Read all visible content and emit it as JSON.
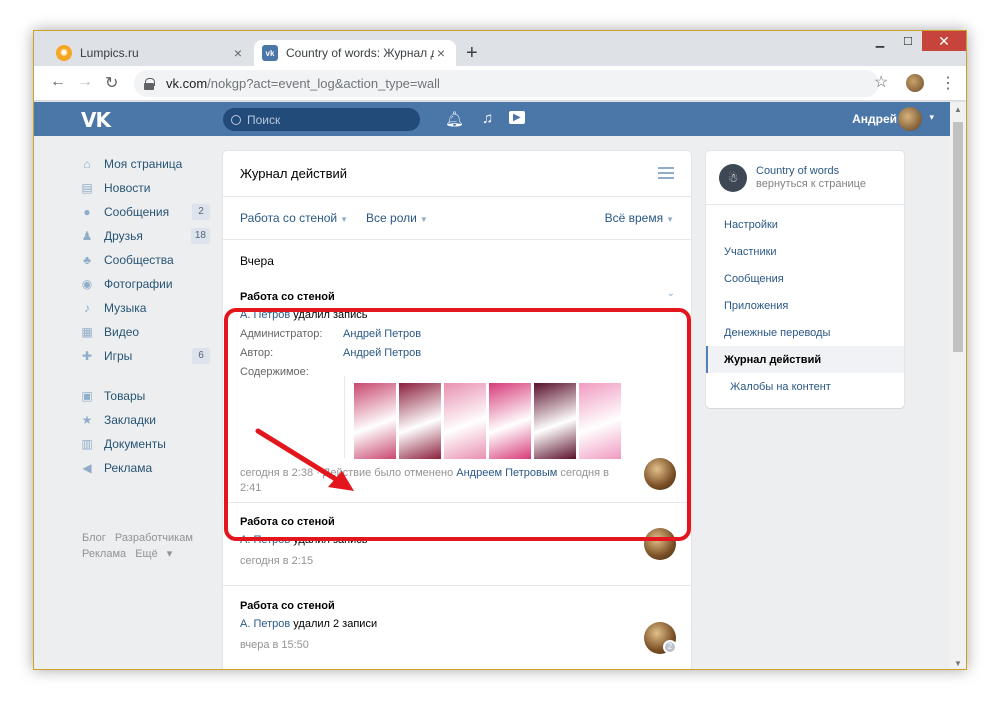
{
  "browser": {
    "tabs": [
      {
        "label": "Lumpics.ru"
      },
      {
        "label": "Country of words: Журнал действ"
      }
    ],
    "url_domain": "vk.com",
    "url_path": "/nokgp?act=event_log&action_type=wall"
  },
  "vk": {
    "search_placeholder": "Поиск",
    "user_name": "Андрей",
    "left_nav": [
      {
        "label": "Моя страница",
        "icon": "home-icon"
      },
      {
        "label": "Новости",
        "icon": "news-icon"
      },
      {
        "label": "Сообщения",
        "icon": "messages-icon",
        "count": "2"
      },
      {
        "label": "Друзья",
        "icon": "friends-icon",
        "count": "18"
      },
      {
        "label": "Сообщества",
        "icon": "groups-icon"
      },
      {
        "label": "Фотографии",
        "icon": "camera-icon"
      },
      {
        "label": "Музыка",
        "icon": "music-icon"
      },
      {
        "label": "Видео",
        "icon": "video-icon"
      },
      {
        "label": "Игры",
        "icon": "games-icon",
        "count": "6"
      },
      {
        "label": "Товары",
        "icon": "shop-icon"
      },
      {
        "label": "Закладки",
        "icon": "star-icon"
      },
      {
        "label": "Документы",
        "icon": "docs-icon"
      },
      {
        "label": "Реклама",
        "icon": "ads-icon"
      }
    ],
    "footer": [
      "Блог",
      "Разработчикам",
      "Реклама",
      "Ещё"
    ]
  },
  "main": {
    "title": "Журнал действий",
    "filter_section": "Работа со стеной",
    "filter_roles": "Все роли",
    "filter_time": "Всё время",
    "day": "Вчера",
    "entries": [
      {
        "title": "Работа со стеной",
        "actor": "А. Петров",
        "action": "удалил запись",
        "admin_label": "Администратор:",
        "admin": "Андрей Петров",
        "author_label": "Автор:",
        "author": "Андрей Петров",
        "content_label": "Содержимое:",
        "time": "сегодня в 2:38",
        "undo_text": "· Действие было отменено",
        "undo_by": "Андреем Петровым",
        "undo_time": "сегодня в 2:41"
      },
      {
        "title": "Работа со стеной",
        "actor": "А. Петров",
        "action": "удалил запись",
        "time": "сегодня в 2:15"
      },
      {
        "title": "Работа со стеной",
        "actor": "А. Петров",
        "action": "удалил 2 записи",
        "time": "вчера в 15:50",
        "badge": "2"
      }
    ],
    "thumb_colors": [
      "#c8486f",
      "#8c1f3c",
      "#e890b0",
      "#d73a7a",
      "#5a0f2a",
      "#f09ac0"
    ]
  },
  "right": {
    "group_name": "Country of words",
    "back": "вернуться к странице",
    "menu": [
      "Настройки",
      "Участники",
      "Сообщения",
      "Приложения",
      "Денежные переводы",
      "Журнал действий",
      "Жалобы на контент"
    ],
    "active_index": 5
  }
}
